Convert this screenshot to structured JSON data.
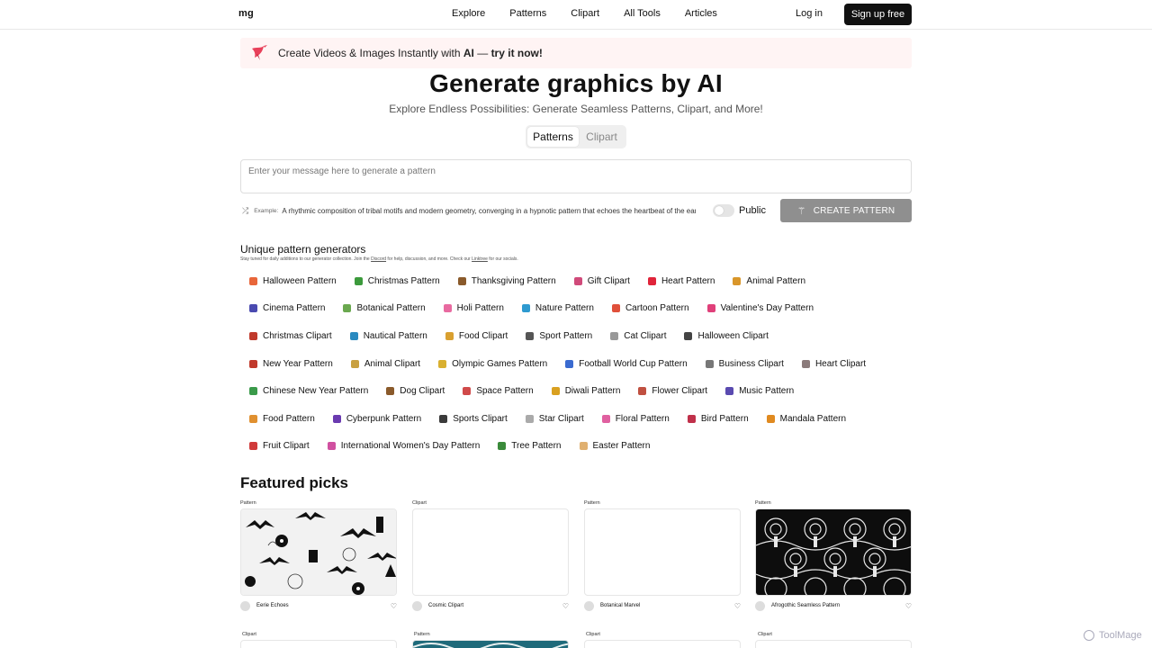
{
  "header": {
    "logo": "mg",
    "nav": [
      "Explore",
      "Patterns",
      "Clipart",
      "All Tools",
      "Articles"
    ],
    "login": "Log in",
    "signup": "Sign up free"
  },
  "banner": {
    "text_pre": "Create Videos & Images Instantly with ",
    "text_ai": "AI",
    "text_mid": " — ",
    "text_cta": "try it now!"
  },
  "hero": {
    "title": "Generate graphics by AI",
    "subtitle": "Explore Endless Possibilities: Generate Seamless Patterns, Clipart, and More!",
    "tabs": [
      "Patterns",
      "Clipart"
    ],
    "active_tab": "Patterns"
  },
  "prompt": {
    "placeholder": "Enter your message here to generate a pattern",
    "example_label": "Example:",
    "example_text": "A rhythmic composition of tribal motifs and modern geometry, converging in a hypnotic pattern that echoes the heartbeat of the earth.",
    "public_label": "Public",
    "public_enabled": false,
    "create_button": "CREATE PATTERN"
  },
  "generators": {
    "title": "Unique pattern generators",
    "subtitle_pre": "Stay tuned for daily additions to our generator collection. Join the ",
    "subtitle_discord": "Discord",
    "subtitle_mid": " for help, discussion, and more. Check our ",
    "subtitle_linktree": "Linktree",
    "subtitle_post": " for our socials.",
    "rows": [
      [
        {
          "label": "Halloween Pattern",
          "color": "#e8663a"
        },
        {
          "label": "Christmas Pattern",
          "color": "#3c9a3c"
        },
        {
          "label": "Thanksgiving Pattern",
          "color": "#8a5a2b"
        },
        {
          "label": "Gift Clipart",
          "color": "#d04a7a"
        },
        {
          "label": "Heart Pattern",
          "color": "#e0243a"
        },
        {
          "label": "Animal Pattern",
          "color": "#d9962a"
        }
      ],
      [
        {
          "label": "Cinema Pattern",
          "color": "#4a4ab0"
        },
        {
          "label": "Botanical Pattern",
          "color": "#6aa84f"
        },
        {
          "label": "Holi Pattern",
          "color": "#e86aa0"
        },
        {
          "label": "Nature Pattern",
          "color": "#2e9ad0"
        },
        {
          "label": "Cartoon Pattern",
          "color": "#e0503a"
        },
        {
          "label": "Valentine's Day Pattern",
          "color": "#e0407a"
        }
      ],
      [
        {
          "label": "Christmas Clipart",
          "color": "#c0392b"
        },
        {
          "label": "Nautical Pattern",
          "color": "#2a8ac0"
        },
        {
          "label": "Food Clipart",
          "color": "#d9a030"
        },
        {
          "label": "Sport Pattern",
          "color": "#555555"
        },
        {
          "label": "Cat Clipart",
          "color": "#999999"
        },
        {
          "label": "Halloween Clipart",
          "color": "#444444"
        }
      ],
      [
        {
          "label": "New Year Pattern",
          "color": "#c0392b"
        },
        {
          "label": "Animal Clipart",
          "color": "#c8a040"
        },
        {
          "label": "Olympic Games Pattern",
          "color": "#d9b030"
        },
        {
          "label": "Football World Cup Pattern",
          "color": "#3a6ad0"
        },
        {
          "label": "Business Clipart",
          "color": "#777777"
        },
        {
          "label": "Heart Clipart",
          "color": "#8a7a7a"
        }
      ],
      [
        {
          "label": "Chinese New Year Pattern",
          "color": "#3a9a4a"
        },
        {
          "label": "Dog Clipart",
          "color": "#8a5a2b"
        },
        {
          "label": "Space Pattern",
          "color": "#d04a4a"
        },
        {
          "label": "Diwali Pattern",
          "color": "#d9a020"
        },
        {
          "label": "Flower Clipart",
          "color": "#c05040"
        },
        {
          "label": "Music Pattern",
          "color": "#5a4ab0"
        }
      ],
      [
        {
          "label": "Food Pattern",
          "color": "#e09030"
        },
        {
          "label": "Cyberpunk Pattern",
          "color": "#6a3ab0"
        },
        {
          "label": "Sports Clipart",
          "color": "#3a3a3a"
        },
        {
          "label": "Star Clipart",
          "color": "#aaaaaa"
        },
        {
          "label": "Floral Pattern",
          "color": "#e060a0"
        },
        {
          "label": "Bird Pattern",
          "color": "#c0304a"
        },
        {
          "label": "Mandala Pattern",
          "color": "#e08a20"
        }
      ],
      [
        {
          "label": "Fruit Clipart",
          "color": "#d03a3a"
        },
        {
          "label": "International Women's Day Pattern",
          "color": "#d050a0"
        },
        {
          "label": "Tree Pattern",
          "color": "#3a8a3a"
        },
        {
          "label": "Easter Pattern",
          "color": "#e0b070"
        }
      ]
    ]
  },
  "featured": {
    "title": "Featured picks",
    "cards": [
      {
        "category": "Pattern",
        "title": "Eerie Echoes",
        "style": "halloween"
      },
      {
        "category": "Clipart",
        "title": "Cosmic Clipart",
        "style": "blank"
      },
      {
        "category": "Pattern",
        "title": "Botanical Marvel",
        "style": "blank"
      },
      {
        "category": "Pattern",
        "title": "Afrogothic Seamless Pattern",
        "style": "gothic"
      }
    ],
    "row2_categories": [
      "Clipart",
      "Pattern",
      "Clipart",
      "Clipart"
    ]
  },
  "watermark": "ToolMage"
}
